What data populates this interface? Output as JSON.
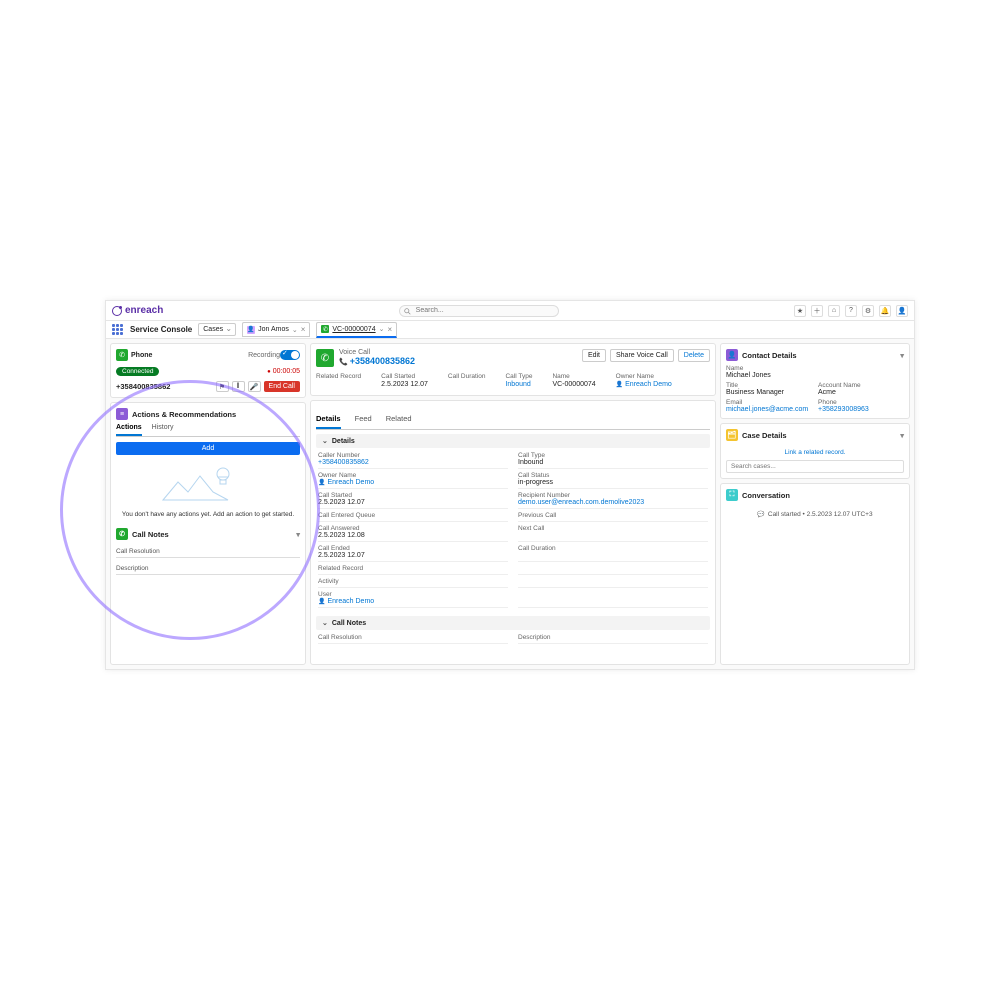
{
  "brand": "enreach",
  "search_placeholder": "Search...",
  "nav": {
    "app_name": "Service Console",
    "select": "Cases",
    "tab1": "Jon Amos",
    "tab2": "VC-00000074"
  },
  "phone": {
    "title": "Phone",
    "recording_label": "Recording",
    "status": "Connected",
    "timer": "00:00:05",
    "caller": "+358400835862",
    "end_call": "End Call"
  },
  "actions": {
    "title": "Actions & Recommendations",
    "tab_actions": "Actions",
    "tab_history": "History",
    "add": "Add",
    "empty": "You don't have any actions yet. Add an action to get started."
  },
  "call_notes": {
    "title": "Call Notes",
    "resolution": "Call Resolution",
    "description": "Description"
  },
  "voice_call": {
    "label": "Voice Call",
    "number": "+358400835862",
    "btn_edit": "Edit",
    "btn_share": "Share Voice Call",
    "btn_delete": "Delete",
    "f_related": "Related Record",
    "f_started": "Call Started",
    "v_started": "2.5.2023 12.07",
    "f_duration": "Call Duration",
    "f_type": "Call Type",
    "v_type": "Inbound",
    "f_name": "Name",
    "v_name": "VC-00000074",
    "f_owner": "Owner Name",
    "v_owner": "Enreach Demo"
  },
  "mid_tabs": {
    "details": "Details",
    "feed": "Feed",
    "related": "Related"
  },
  "details": {
    "section": "Details",
    "caller_number_l": "Caller Number",
    "caller_number_v": "+358400835862",
    "call_type_l": "Call Type",
    "call_type_v": "Inbound",
    "owner_l": "Owner Name",
    "owner_v": "Enreach Demo",
    "status_l": "Call Status",
    "status_v": "in-progress",
    "started_l": "Call Started",
    "started_v": "2.5.2023 12.07",
    "recipient_l": "Recipient Number",
    "recipient_v": "demo.user@enreach.com.demolive2023",
    "queue_l": "Call Entered Queue",
    "prev_l": "Previous Call",
    "answered_l": "Call Answered",
    "answered_v": "2.5.2023 12.08",
    "next_l": "Next Call",
    "ended_l": "Call Ended",
    "ended_v": "2.5.2023 12.07",
    "duration_l": "Call Duration",
    "related_rec_l": "Related Record",
    "activity_l": "Activity",
    "user_l": "User",
    "user_v": "Enreach Demo",
    "notes_section": "Call Notes",
    "resolution_l": "Call Resolution",
    "description_l": "Description"
  },
  "contact": {
    "title": "Contact Details",
    "name_l": "Name",
    "name_v": "Michael Jones",
    "title_l": "Title",
    "title_v": "Business Manager",
    "account_l": "Account Name",
    "account_v": "Acme",
    "email_l": "Email",
    "email_v": "michael.jones@acme.com",
    "phone_l": "Phone",
    "phone_v": "+358293008963"
  },
  "case": {
    "title": "Case Details",
    "link": "Link a related record.",
    "search_ph": "Search cases..."
  },
  "conv": {
    "title": "Conversation",
    "item": "Call started • 2.5.2023 12.07 UTC+3"
  }
}
